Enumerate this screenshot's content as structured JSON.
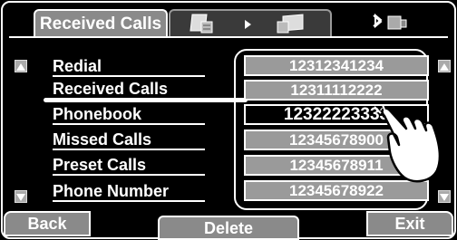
{
  "header": {
    "title": "Received Calls",
    "phone_icon": "phone-icon",
    "arrow_icon": "right-arrow-icon",
    "device_icon": "device-icon",
    "bluetooth_icon": "bluetooth-icon",
    "battery_icon": "battery-icon"
  },
  "menu": {
    "items": [
      {
        "label": "Redial"
      },
      {
        "label": "Received Calls"
      },
      {
        "label": "Phonebook"
      },
      {
        "label": "Missed Calls"
      },
      {
        "label": "Preset Calls"
      },
      {
        "label": "Phone Number"
      }
    ],
    "selected_index": 1
  },
  "numbers": {
    "items": [
      {
        "value": "12312341234"
      },
      {
        "value": "12311112222"
      },
      {
        "value": "12322223333"
      },
      {
        "value": "12345678900"
      },
      {
        "value": "12345678911"
      },
      {
        "value": "12345678922"
      }
    ],
    "selected_index": 2
  },
  "buttons": {
    "back": "Back",
    "delete": "Delete",
    "exit": "Exit"
  },
  "colors": {
    "background": "#000000",
    "button_fill": "#8a8a8a",
    "row_fill": "#9a9a9a",
    "text": "#ffffff"
  }
}
